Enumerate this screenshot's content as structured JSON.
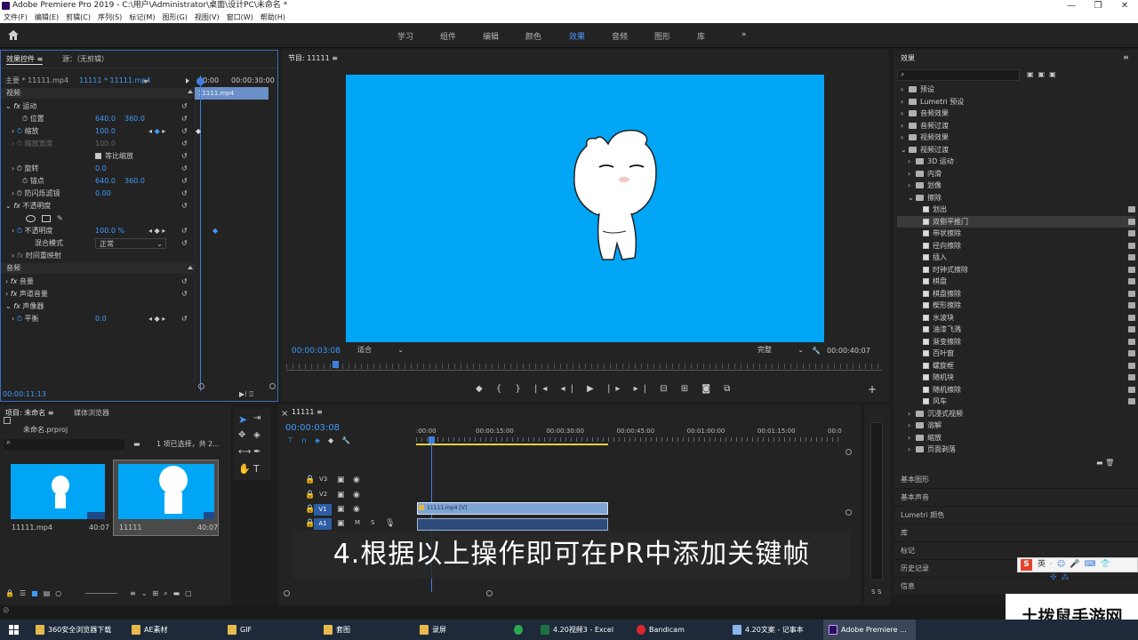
{
  "titlebar": {
    "title": "Adobe Premiere Pro 2019 - C:\\用户\\Administrator\\桌面\\设计PC\\未命名 *"
  },
  "menu": [
    "文件(F)",
    "编辑(E)",
    "剪辑(C)",
    "序列(S)",
    "标记(M)",
    "图形(G)",
    "视图(V)",
    "窗口(W)",
    "帮助(H)"
  ],
  "workspaces": [
    "学习",
    "组件",
    "编辑",
    "颜色",
    "效果",
    "音频",
    "图形",
    "库"
  ],
  "active_workspace": "效果",
  "effect_controls": {
    "tab": "效果控件",
    "source_tab": "源：（无剪辑）",
    "master_label": "主要 * 11111.mp4",
    "sequence_label": "11111 * 11111.mp4",
    "tl_start": "00:00",
    "tl_end": "00:00:30:00",
    "clip_name": "11111.mp4",
    "video_header": "视频",
    "motion": "运动",
    "position_label": "位置",
    "position_x": "640.0",
    "position_y": "360.0",
    "scale_label": "缩放",
    "scale_value": "100.0",
    "scale_width_label": "缩放宽度",
    "scale_width_value": "100.0",
    "uniform_scale_label": "等比缩放",
    "rotation_label": "旋转",
    "rotation_value": "0.0",
    "anchor_label": "锚点",
    "anchor_x": "640.0",
    "anchor_y": "360.0",
    "antiflicker_label": "防闪烁滤镜",
    "antiflicker_value": "0.00",
    "opacity_group": "不透明度",
    "opacity_label": "不透明度",
    "opacity_value": "100.0 %",
    "blend_label": "混合模式",
    "blend_value": "正常",
    "time_remap": "时间重映射",
    "audio_header": "音频",
    "volume": "音量",
    "channel_volume": "声道音量",
    "panner": "声像器",
    "balance_label": "平衡",
    "balance_value": "0.0",
    "timecode": "00:00:11:13"
  },
  "program": {
    "tab": "节目: 11111",
    "timecode": "00:00:03:08",
    "fit": "适合",
    "quality": "完整",
    "duration": "00:00:40:07"
  },
  "effects_panel": {
    "title": "效果",
    "items": [
      {
        "label": "预设",
        "level": 0,
        "type": "folder"
      },
      {
        "label": "Lumetri 预设",
        "level": 0,
        "type": "folder"
      },
      {
        "label": "音频效果",
        "level": 0,
        "type": "folder"
      },
      {
        "label": "音频过渡",
        "level": 0,
        "type": "folder"
      },
      {
        "label": "视频效果",
        "level": 0,
        "type": "folder"
      },
      {
        "label": "视频过渡",
        "level": 0,
        "type": "folder",
        "open": true
      },
      {
        "label": "3D 运动",
        "level": 1,
        "type": "folder"
      },
      {
        "label": "内滑",
        "level": 1,
        "type": "folder"
      },
      {
        "label": "划像",
        "level": 1,
        "type": "folder"
      },
      {
        "label": "擦除",
        "level": 1,
        "type": "folder",
        "open": true
      },
      {
        "label": "划出",
        "level": 2,
        "type": "effect"
      },
      {
        "label": "双侧平推门",
        "level": 2,
        "type": "effect",
        "selected": true
      },
      {
        "label": "带状擦除",
        "level": 2,
        "type": "effect"
      },
      {
        "label": "径向擦除",
        "level": 2,
        "type": "effect"
      },
      {
        "label": "插入",
        "level": 2,
        "type": "effect"
      },
      {
        "label": "时钟式擦除",
        "level": 2,
        "type": "effect"
      },
      {
        "label": "棋盘",
        "level": 2,
        "type": "effect"
      },
      {
        "label": "棋盘擦除",
        "level": 2,
        "type": "effect"
      },
      {
        "label": "楔形擦除",
        "level": 2,
        "type": "effect"
      },
      {
        "label": "水波块",
        "level": 2,
        "type": "effect"
      },
      {
        "label": "油漆飞溅",
        "level": 2,
        "type": "effect"
      },
      {
        "label": "渐变擦除",
        "level": 2,
        "type": "effect"
      },
      {
        "label": "百叶窗",
        "level": 2,
        "type": "effect"
      },
      {
        "label": "螺旋框",
        "level": 2,
        "type": "effect"
      },
      {
        "label": "随机块",
        "level": 2,
        "type": "effect"
      },
      {
        "label": "随机擦除",
        "level": 2,
        "type": "effect"
      },
      {
        "label": "风车",
        "level": 2,
        "type": "effect"
      },
      {
        "label": "沉浸式视频",
        "level": 1,
        "type": "folder"
      },
      {
        "label": "溶解",
        "level": 1,
        "type": "folder"
      },
      {
        "label": "缩放",
        "level": 1,
        "type": "folder"
      },
      {
        "label": "页面剥落",
        "level": 1,
        "type": "folder"
      }
    ],
    "side_panels": [
      "基本图形",
      "基本声音",
      "Lumetri 颜色",
      "库",
      "标记",
      "历史记录",
      "信息"
    ]
  },
  "project": {
    "tab": "项目: 未命名",
    "media_tab": "媒体浏览器",
    "file": "未命名.prproj",
    "selection": "1 项已选择，共 2...",
    "items": [
      {
        "name": "11111.mp4",
        "duration": "40:07"
      },
      {
        "name": "11111",
        "duration": "40:07"
      }
    ]
  },
  "timeline": {
    "tab": "11111",
    "timecode": "00:00:03:08",
    "ruler": [
      ":00:00",
      "00:00:15:00",
      "00:00:30:00",
      "00:00:45:00",
      "00:01:00:00",
      "00:01:15:00",
      "00:0"
    ],
    "tracks": [
      "V3",
      "V2",
      "V1",
      "A1"
    ],
    "clip_label": "11111.mp4 [V]",
    "m_label": "M",
    "s_label": "S"
  },
  "subtitle": "4.根据以上操作即可在PR中添加关键帧",
  "ime": {
    "brand": "S",
    "label": "英"
  },
  "meter": {
    "labels": [
      "S",
      "S"
    ]
  },
  "watermark": "土拨鼠手游网",
  "taskbar": [
    {
      "label": "360安全浏览器下载"
    },
    {
      "label": "AE素材"
    },
    {
      "label": "GIF"
    },
    {
      "label": "套图"
    },
    {
      "label": "录屏"
    },
    {
      "label": "4.20视频3 - Excel"
    },
    {
      "label": "Bandicam"
    },
    {
      "label": "4.20文案 - 记事本"
    },
    {
      "label": "Adobe Premiere ..."
    }
  ]
}
